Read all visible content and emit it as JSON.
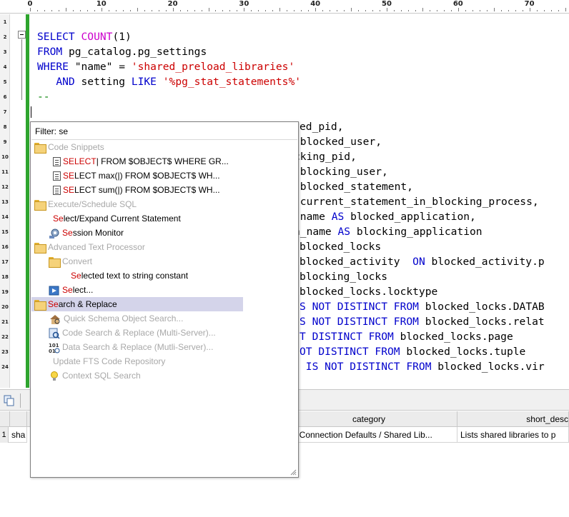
{
  "ruler": {
    "labels": [
      "0",
      "10",
      "20",
      "30",
      "40",
      "50",
      "60",
      "70"
    ]
  },
  "gutter": {
    "line_numbers": [
      "1",
      "2",
      "3",
      "4",
      "5",
      "6",
      "7",
      "8",
      "9",
      "10",
      "11",
      "12",
      "13",
      "14",
      "15",
      "16",
      "17",
      "18",
      "19",
      "20",
      "21",
      "22",
      "23",
      "24"
    ]
  },
  "editor": {
    "lines": {
      "l2": {
        "kw1": "SELECT ",
        "fn": "COUNT",
        "rest": "(1)"
      },
      "l3": {
        "kw1": "FROM ",
        "rest": "pg_catalog.pg_settings"
      },
      "l4": {
        "kw1": "WHERE ",
        "rest": "\"name\" = ",
        "str": "'shared_preload_libraries'"
      },
      "l5": {
        "indent": "   ",
        "kw1": "AND ",
        "rest": "setting ",
        "kw2": "LIKE ",
        "str": "'%pg_stat_statements%'"
      },
      "l6": {
        "cmt": "--"
      },
      "l8": {
        "rest": "ed_pid,"
      },
      "l9": {
        "rest": " blocked_user,"
      },
      "l10": {
        "rest": "cking_pid,"
      },
      "l11": {
        "rest": " blocking_user,"
      },
      "l12": {
        "rest": " blocked_statement,"
      },
      "l13": {
        "rest": " current_statement_in_blocking_process,"
      },
      "l14": {
        "rest": " name ",
        "kw1": "AS ",
        "rest2": "blocked_application,"
      },
      "l15": {
        "rest": "n_name ",
        "kw1": "AS ",
        "rest2": "blocking_application"
      },
      "l16": {
        "rest": "blocked_locks"
      },
      "l17": {
        "rest": "blocked_activity  ",
        "kw1": "ON ",
        "rest2": "blocked_activity.p"
      },
      "l18": {
        "rest": "blocking_locks"
      },
      "l19": {
        "rest": "blocked_locks.locktype"
      },
      "l20": {
        "kw1": "S NOT DISTINCT FROM ",
        "rest": "blocked_locks.DATAB"
      },
      "l21": {
        "kw1": "S NOT DISTINCT FROM ",
        "rest": "blocked_locks.relat"
      },
      "l22": {
        "kw1": "T DISTINCT FROM ",
        "rest": "blocked_locks.page"
      },
      "l23": {
        "kw1": "OT DISTINCT FROM ",
        "rest": "blocked_locks.tuple"
      },
      "l24": {
        "kw1": " IS NOT DISTINCT FROM ",
        "rest": "blocked_locks.vir"
      }
    }
  },
  "popup": {
    "filter": "Filter: se",
    "items": [
      {
        "label": "Code Snippets",
        "kind": "folder",
        "disabled": true
      },
      {
        "hl": "SELECT",
        "label": "| FROM $OBJECT$ WHERE GR...",
        "kind": "snippet"
      },
      {
        "hl": "SE",
        "label": "LECT max(|) FROM $OBJECT$ WH...",
        "kind": "snippet"
      },
      {
        "hl": "SE",
        "label": "LECT sum(|) FROM $OBJECT$ WH...",
        "kind": "snippet"
      },
      {
        "label": "Execute/Schedule SQL",
        "kind": "folder",
        "disabled": true
      },
      {
        "hl": "Se",
        "label": "lect/Expand Current Statement",
        "kind": "none"
      },
      {
        "hl": "Se",
        "label": "ssion Monitor",
        "kind": "gear"
      },
      {
        "label": "Advanced Text Processor",
        "kind": "folder",
        "disabled": true
      },
      {
        "label": "Convert",
        "kind": "folder",
        "disabled": true
      },
      {
        "hl": "Se",
        "label": "lected text to string constant",
        "kind": "none"
      },
      {
        "hl": "Se",
        "label": "lect...",
        "kind": "select"
      },
      {
        "hl": "Se",
        "label": "arch & Replace",
        "kind": "folder",
        "selected": true
      },
      {
        "label": "Quick Schema Object Search...",
        "kind": "house",
        "disabled": true
      },
      {
        "label": "Code Search & Replace (Multi-Server)...",
        "kind": "search",
        "disabled": true
      },
      {
        "label": "Data Search & Replace (Mutli-Server)...",
        "kind": "binary",
        "disabled": true
      },
      {
        "label": "Update FTS Code Repository",
        "kind": "none",
        "disabled": true
      },
      {
        "label": "Context SQL Search",
        "kind": "bulb",
        "disabled": true
      }
    ]
  },
  "results": {
    "headers": {
      "category": "category",
      "short_desc": "short_desc"
    },
    "row": {
      "num": "1",
      "name": "sha",
      "category": "t Connection Defaults / Shared Lib...",
      "short_desc": "Lists shared libraries to p"
    }
  },
  "colors": {
    "keyword": "#0000cc",
    "function": "#cc00cc",
    "string": "#cc0000",
    "comment": "#008000",
    "change_bar": "#2ea52e",
    "highlight": "#cc0000",
    "selected_bg": "#d4d4ea"
  }
}
